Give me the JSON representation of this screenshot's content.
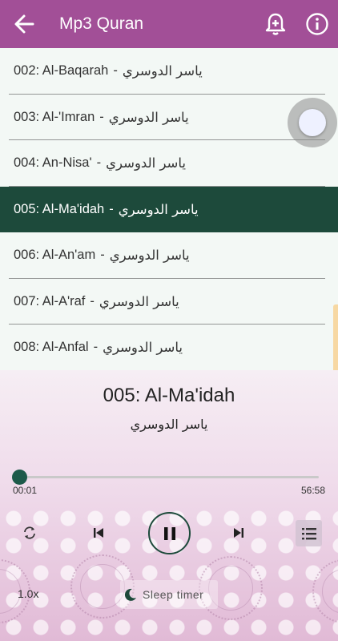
{
  "app_bar": {
    "title": "Mp3 Quran",
    "icons": [
      "arrow-left-icon",
      "bell-plus-icon",
      "info-icon"
    ],
    "color": "#a24f97"
  },
  "playlist": [
    {
      "surah": "002: Al-Baqarah",
      "reciter": "ياسر الدوسري",
      "active": false
    },
    {
      "surah": "003: Al-'Imran",
      "reciter": "ياسر الدوسري",
      "active": false
    },
    {
      "surah": "004: An-Nisa'",
      "reciter": "ياسر الدوسري",
      "active": false
    },
    {
      "surah": "005: Al-Ma'idah",
      "reciter": "ياسر الدوسري",
      "active": true
    },
    {
      "surah": "006: Al-An'am",
      "reciter": "ياسر الدوسري",
      "active": false
    },
    {
      "surah": "007: Al-A'raf",
      "reciter": "ياسر الدوسري",
      "active": false
    },
    {
      "surah": "008: Al-Anfal",
      "reciter": "ياسر الدوسري",
      "active": false
    }
  ],
  "separator": "-",
  "player": {
    "title": "005: Al-Ma'idah",
    "reciter": "ياسر الدوسري",
    "current_time": "00:01",
    "total_time": "56:58",
    "progress": 0.0003,
    "controls": [
      "repeat-icon",
      "previous-icon",
      "pause-icon",
      "next-icon",
      "playlist-icon"
    ],
    "speed": "1.0x",
    "sleep_timer": "Sleep timer",
    "accent": "#1d4a3b"
  }
}
